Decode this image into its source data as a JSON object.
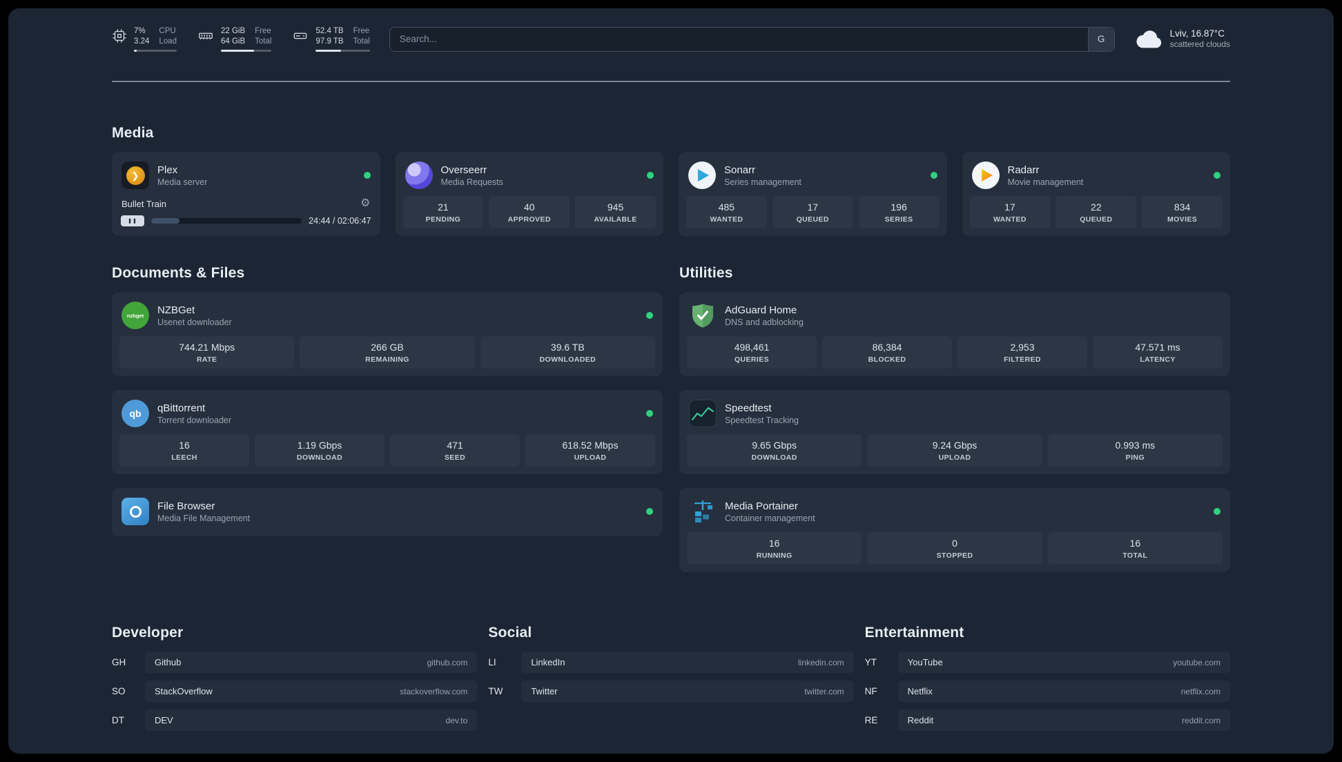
{
  "colors": {
    "page_background": "#1c2533",
    "card_background": "#252f3e",
    "status_online": "#2fd181",
    "plex_orange": "#e5a00d",
    "overseerr_purple": "#5446d8",
    "sonarr_blue": "#30a8dd",
    "radarr_yellow": "#f5b822",
    "nzbget_green": "#42a539",
    "qbittorrent_blue": "#4f9bd9",
    "filebrowser_blue": "#2f80c3",
    "adguard_green": "#67b173",
    "speedtest_green": "#34d399",
    "portainer_blue": "#2ea3da"
  },
  "topbar": {
    "cpu": {
      "icon": "cpu-chip-icon",
      "value_top": "7%",
      "value_bottom": "3.24",
      "label_top": "CPU",
      "label_bottom": "Load",
      "bar_percent": 7
    },
    "memory": {
      "icon": "memory-icon",
      "value_top": "22 GiB",
      "value_bottom": "64 GiB",
      "label_top": "Free",
      "label_bottom": "Total",
      "bar_percent": 66
    },
    "disk": {
      "icon": "hard-drive-icon",
      "value_top": "52.4 TB",
      "value_bottom": "97.9 TB",
      "label_top": "Free",
      "label_bottom": "Total",
      "bar_percent": 47
    },
    "search": {
      "placeholder": "Search...",
      "provider_button": "G"
    },
    "weather": {
      "icon": "cloud-icon",
      "location": "Lviv, 16.87°C",
      "condition": "scattered clouds"
    }
  },
  "groups": {
    "media": {
      "title": "Media",
      "plex": {
        "name": "Plex",
        "desc": "Media server",
        "icon_glyph": "❯",
        "now_playing": "Bullet Train",
        "pause_glyph": "❚❚",
        "time": "24:44 / 02:06:47",
        "progress_percent": 19
      },
      "overseerr": {
        "name": "Overseerr",
        "desc": "Media Requests",
        "stats": [
          {
            "value": "21",
            "label": "PENDING"
          },
          {
            "value": "40",
            "label": "APPROVED"
          },
          {
            "value": "945",
            "label": "AVAILABLE"
          }
        ]
      },
      "sonarr": {
        "name": "Sonarr",
        "desc": "Series management",
        "stats": [
          {
            "value": "485",
            "label": "WANTED"
          },
          {
            "value": "17",
            "label": "QUEUED"
          },
          {
            "value": "196",
            "label": "SERIES"
          }
        ]
      },
      "radarr": {
        "name": "Radarr",
        "desc": "Movie management",
        "stats": [
          {
            "value": "17",
            "label": "WANTED"
          },
          {
            "value": "22",
            "label": "QUEUED"
          },
          {
            "value": "834",
            "label": "MOVIES"
          }
        ]
      }
    },
    "documents": {
      "title": "Documents & Files",
      "nzbget": {
        "name": "NZBGet",
        "desc": "Usenet downloader",
        "icon_text": "nzbget",
        "stats": [
          {
            "value": "744.21 Mbps",
            "label": "RATE"
          },
          {
            "value": "266 GB",
            "label": "REMAINING"
          },
          {
            "value": "39.6 TB",
            "label": "DOWNLOADED"
          }
        ]
      },
      "qbittorrent": {
        "name": "qBittorrent",
        "desc": "Torrent downloader",
        "icon_text": "qb",
        "stats": [
          {
            "value": "16",
            "label": "LEECH"
          },
          {
            "value": "1.19 Gbps",
            "label": "DOWNLOAD"
          },
          {
            "value": "471",
            "label": "SEED"
          },
          {
            "value": "618.52 Mbps",
            "label": "UPLOAD"
          }
        ]
      },
      "filebrowser": {
        "name": "File Browser",
        "desc": "Media File Management"
      }
    },
    "utilities": {
      "title": "Utilities",
      "adguard": {
        "name": "AdGuard Home",
        "desc": "DNS and adblocking",
        "stats": [
          {
            "value": "498,461",
            "label": "QUERIES"
          },
          {
            "value": "86,384",
            "label": "BLOCKED"
          },
          {
            "value": "2,953",
            "label": "FILTERED"
          },
          {
            "value": "47.571 ms",
            "label": "LATENCY"
          }
        ]
      },
      "speedtest": {
        "name": "Speedtest",
        "desc": "Speedtest Tracking",
        "stats": [
          {
            "value": "9.65 Gbps",
            "label": "DOWNLOAD"
          },
          {
            "value": "9.24 Gbps",
            "label": "UPLOAD"
          },
          {
            "value": "0.993 ms",
            "label": "PING"
          }
        ]
      },
      "portainer": {
        "name": "Media Portainer",
        "desc": "Container management",
        "stats": [
          {
            "value": "16",
            "label": "RUNNING"
          },
          {
            "value": "0",
            "label": "STOPPED"
          },
          {
            "value": "16",
            "label": "TOTAL"
          }
        ]
      }
    }
  },
  "bookmarks": {
    "developer": {
      "title": "Developer",
      "items": [
        {
          "abbr": "GH",
          "name": "Github",
          "url": "github.com"
        },
        {
          "abbr": "SO",
          "name": "StackOverflow",
          "url": "stackoverflow.com"
        },
        {
          "abbr": "DT",
          "name": "DEV",
          "url": "dev.to"
        }
      ]
    },
    "social": {
      "title": "Social",
      "items": [
        {
          "abbr": "LI",
          "name": "LinkedIn",
          "url": "linkedin.com"
        },
        {
          "abbr": "TW",
          "name": "Twitter",
          "url": "twitter.com"
        }
      ]
    },
    "entertainment": {
      "title": "Entertainment",
      "items": [
        {
          "abbr": "YT",
          "name": "YouTube",
          "url": "youtube.com"
        },
        {
          "abbr": "NF",
          "name": "Netflix",
          "url": "netflix.com"
        },
        {
          "abbr": "RE",
          "name": "Reddit",
          "url": "reddit.com"
        }
      ]
    }
  }
}
